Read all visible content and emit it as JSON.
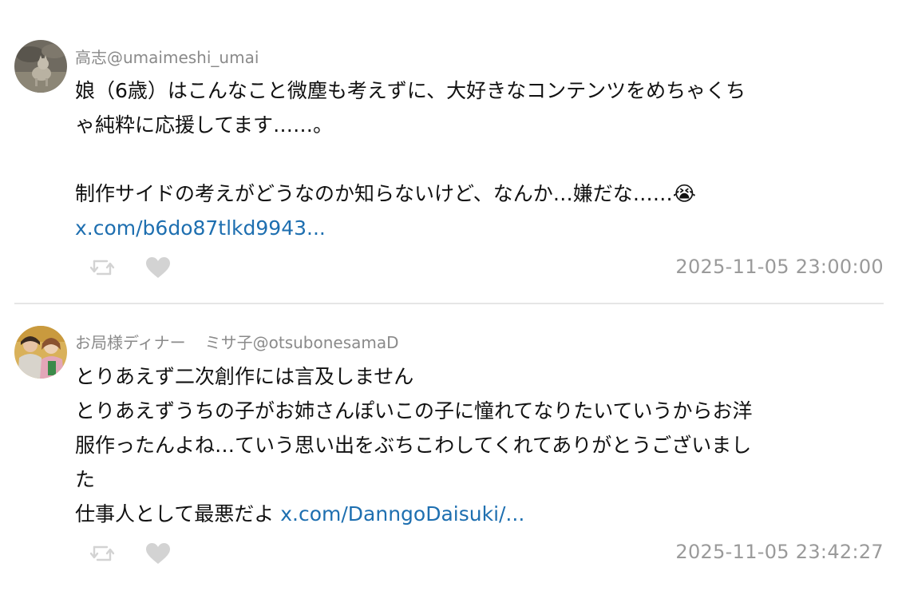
{
  "posts": [
    {
      "display_name": "高志",
      "handle": "@umaimeshi_umai",
      "body_lines": [
        "娘（6歳）はこんなこと微塵も考えずに、大好きなコンテンツをめちゃくち",
        "ゃ純粋に応援してます……。",
        "",
        "制作サイドの考えがどうなのか知らないけど、なんか…嫌だな……😭"
      ],
      "link": "x.com/b6do87tlkd9943...",
      "timestamp": "2025-11-05 23:00:00",
      "avatar_icon": "cat-avatar"
    },
    {
      "display_name": "お局様ディナー",
      "display_name_2": "ミサ子",
      "handle": "@otsubonesamaD",
      "body_lines": [
        "とりあえず二次創作には言及しません",
        "とりあえずうちの子がお姉さんぽいこの子に憧れてなりたいていうからお洋",
        "服作ったんよね…ていう思い出をぶちこわしてくれてありがとうございまし",
        "た"
      ],
      "last_line_text": "仕事人として最悪だよ",
      "link": "x.com/DanngoDaisuki/...",
      "timestamp": "2025-11-05 23:42:27",
      "avatar_icon": "people-avatar"
    }
  ],
  "icons": {
    "retweet": "retweet-icon",
    "like": "heart-icon"
  },
  "colors": {
    "link": "#1e6fb0",
    "meta": "#9a9a9a",
    "icon": "#cfcfcf"
  }
}
